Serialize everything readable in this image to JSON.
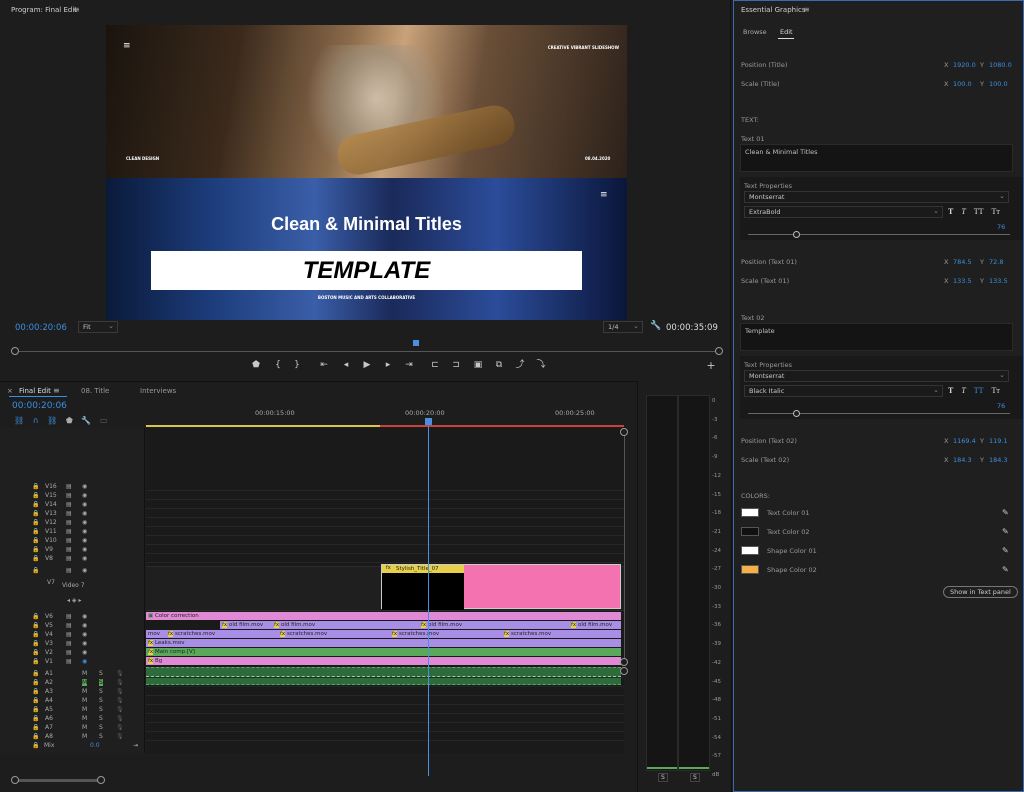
{
  "program": {
    "title": "Program: Final Edit",
    "timecode_current": "00:00:20:06",
    "fit_option": "Fit",
    "resolution": "1/4",
    "timecode_total": "00:00:35:09",
    "video": {
      "top_tag": "CREATIVE VIBRANT SLIDESHOW",
      "left_caption": "CLEAN DESIGN",
      "date_caption": "08.04.2020",
      "headline": "Clean & Minimal Titles",
      "banner": "TEMPLATE",
      "footer_caption": "BOSTON MUSIC AND ARTS COLLABORATIVE"
    },
    "transport_icons": [
      "marker",
      "in",
      "out",
      "go-in",
      "step-back",
      "play",
      "step-forward",
      "go-out",
      "lift",
      "extract",
      "export-frame",
      "compare",
      "insert",
      "overwrite"
    ]
  },
  "timeline": {
    "tabs": [
      "Final Edit",
      "08. Title",
      "Interviews"
    ],
    "timecode": "00:00:20:06",
    "ruler": [
      "00:00:15:00",
      "00:00:20:00",
      "00:00:25:00"
    ],
    "video_tracks": [
      "V16",
      "V15",
      "V14",
      "V13",
      "V12",
      "V11",
      "V10",
      "V9",
      "V8"
    ],
    "v7": {
      "name": "V7",
      "label": "Video 7"
    },
    "lower_video_tracks": [
      "V6",
      "V5",
      "V4",
      "V3",
      "V2",
      "V1"
    ],
    "audio_tracks": [
      "A1",
      "A2",
      "A3",
      "A4",
      "A5",
      "A6",
      "A7",
      "A8"
    ],
    "mute_label": "M",
    "solo_label": "S",
    "mix": {
      "label": "Mix",
      "value": "0.0"
    },
    "clips": {
      "stylish_title": "Stylish_Title_07",
      "color_correction": "Color correction",
      "old_film": "old film.mov",
      "scratches": "scratches.mov",
      "mov_fragment": "mov",
      "leaks": "Leaks.mov",
      "main_comp": "Main comp.[V]",
      "bg": "Bg",
      "fx": "fx"
    }
  },
  "meters": {
    "scale": [
      "0",
      "-3",
      "-6",
      "-9",
      "-12",
      "-15",
      "-18",
      "-21",
      "-24",
      "-27",
      "-30",
      "-33",
      "-36",
      "-39",
      "-42",
      "-45",
      "-48",
      "-51",
      "-54",
      "-57",
      "dB"
    ],
    "solo_buttons": [
      "S",
      "S"
    ]
  },
  "essential_graphics": {
    "title": "Essential Graphics",
    "tabs": [
      "Browse",
      "Edit"
    ],
    "position_title": {
      "label": "Position (Title)",
      "x": "1920.0",
      "y": "1080.0"
    },
    "scale_title": {
      "label": "Scale (Title)",
      "x": "100.0",
      "y": "100.0"
    },
    "text_section": "TEXT:",
    "text01": {
      "label": "Text 01",
      "value": "Clean & Minimal Titles",
      "props_label": "Text Properties",
      "font": "Montserrat",
      "style": "ExtraBold",
      "size": "76",
      "position": {
        "label": "Position (Text 01)",
        "x": "784.5",
        "y": "72.8"
      },
      "scale": {
        "label": "Scale (Text 01)",
        "x": "133.5",
        "y": "133.5"
      }
    },
    "text02": {
      "label": "Text 02",
      "value": "Template",
      "props_label": "Text Properties",
      "font": "Montserrat",
      "style": "Black Italic",
      "size": "76",
      "position": {
        "label": "Position (Text 02)",
        "x": "1169.4",
        "y": "119.1"
      },
      "scale": {
        "label": "Scale (Text 02)",
        "x": "184.3",
        "y": "184.3"
      }
    },
    "style_buttons": [
      "T",
      "T",
      "TT",
      "Tт"
    ],
    "colors_section": "COLORS:",
    "colors": [
      {
        "label": "Text Color 01",
        "hex": "#ffffff"
      },
      {
        "label": "Text Color 02",
        "hex": "#111111"
      },
      {
        "label": "Shape Color 01",
        "hex": "#ffffff"
      },
      {
        "label": "Shape Color 02",
        "hex": "#f5b04a"
      }
    ],
    "show_in_text_panel": "Show in Text panel",
    "x_label": "X",
    "y_label": "Y"
  },
  "colors": {
    "accent_blue": "#3a8fe0",
    "clip_pink": "#f472b0",
    "clip_purple": "#a98ee6",
    "clip_green": "#5aa85a",
    "clip_yellow": "#e6d04a",
    "playhead": "#4a90e2"
  }
}
